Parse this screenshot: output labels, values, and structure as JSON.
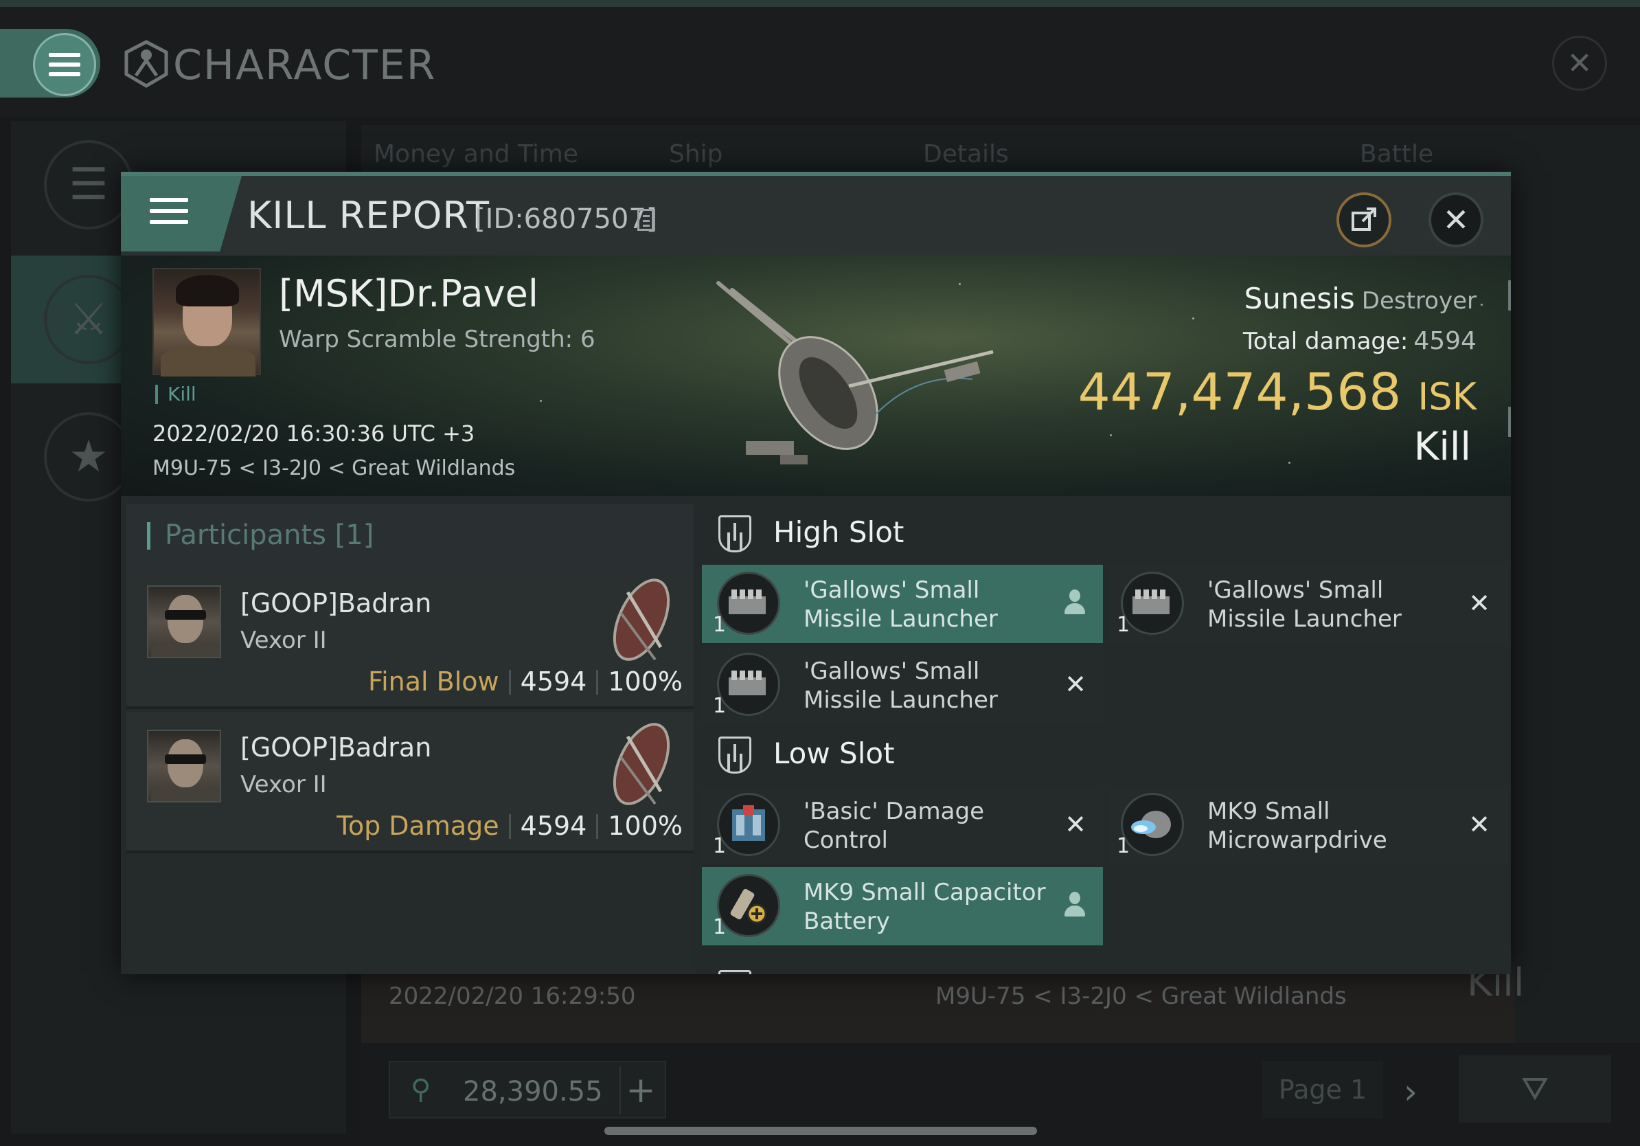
{
  "screen": {
    "title": "CHARACTER",
    "tabs": [
      "Money and Time",
      "Ship",
      "Details",
      "Battle Status"
    ],
    "background_row": {
      "date": "2022/02/20  16:29:50",
      "location": "M9U-75 < I3-2J0 < Great Wildlands",
      "result": "Kill"
    },
    "wallet": "28,390.55",
    "page_label": "Page 1"
  },
  "kill_report": {
    "title": "KILL REPORT",
    "id": "[ID:6807507]",
    "victim": {
      "name": "[MSK]Dr.Pavel",
      "subtitle": "Warp Scramble Strength: 6",
      "tag": "Kill",
      "time": "2022/02/20 16:30:36 UTC +3",
      "location": "M9U-75 < I3-2J0 < Great Wildlands"
    },
    "ship": {
      "name": "Sunesis",
      "class": "Destroyer",
      "total_damage_label": "Total damage:",
      "total_damage": "4594",
      "isk_value": "447,474,568",
      "isk_unit": "ISK",
      "result": "Kill"
    },
    "participants": {
      "label": "Participants [1]",
      "rows": [
        {
          "name": "[GOOP]Badran",
          "ship": "Vexor II",
          "tag": "Final Blow",
          "damage": "4594",
          "percent": "100%"
        },
        {
          "name": "[GOOP]Badran",
          "ship": "Vexor II",
          "tag": "Top Damage",
          "damage": "4594",
          "percent": "100%"
        }
      ]
    },
    "high_slot": {
      "title": "High Slot",
      "modules": [
        {
          "name": "'Gallows' Small Missile Launcher",
          "qty": "1",
          "status": "dropped"
        },
        {
          "name": "'Gallows' Small Missile Launcher",
          "qty": "1",
          "status": "destroyed"
        },
        {
          "name": "'Gallows' Small Missile Launcher",
          "qty": "1",
          "status": "destroyed"
        }
      ]
    },
    "low_slot": {
      "title": "Low Slot",
      "modules": [
        {
          "name": "'Basic' Damage Control",
          "qty": "1",
          "status": "destroyed"
        },
        {
          "name": "MK9 Small Microwarpdrive",
          "qty": "1",
          "status": "destroyed"
        },
        {
          "name": "MK9 Small Capacitor Battery",
          "qty": "1",
          "status": "dropped"
        }
      ]
    }
  },
  "colors": {
    "accent": "#3f6d62",
    "isk_gold": "#e8c86a",
    "tag_gold": "#c9a55a",
    "dropped_bg": "#3a6e63"
  }
}
